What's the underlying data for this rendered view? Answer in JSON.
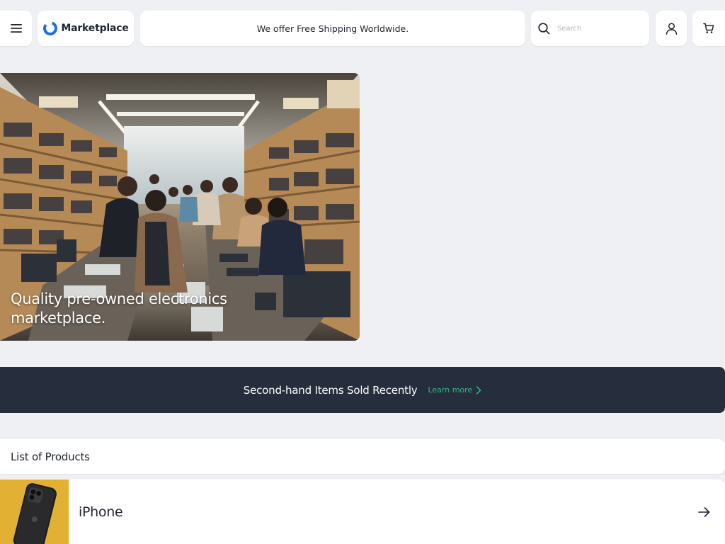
{
  "header": {
    "menu_icon": "hamburger-menu-icon",
    "logo": {
      "icon": "marketplace-logo-icon",
      "text": "Marketplace",
      "accent": "#1f6fe0"
    },
    "promo": "We offer Free Shipping Worldwide.",
    "search": {
      "placeholder": "Search",
      "value": "",
      "icon": "search-icon"
    },
    "account_icon": "user-icon",
    "cart_icon": "cart-icon"
  },
  "hero": {
    "title": "Quality pre-owned electronics marketplace.",
    "image": "electronics-store-photo"
  },
  "sold_banner": {
    "text": "Second-hand Items Sold Recently",
    "link": "Learn more",
    "link_color": "#2eb88a",
    "background": "#262d3d"
  },
  "products": {
    "title": "List of Products",
    "items": [
      {
        "name": "iPhone",
        "thumb_color": "#e2b133",
        "arrow_icon": "arrow-right-icon"
      }
    ]
  }
}
